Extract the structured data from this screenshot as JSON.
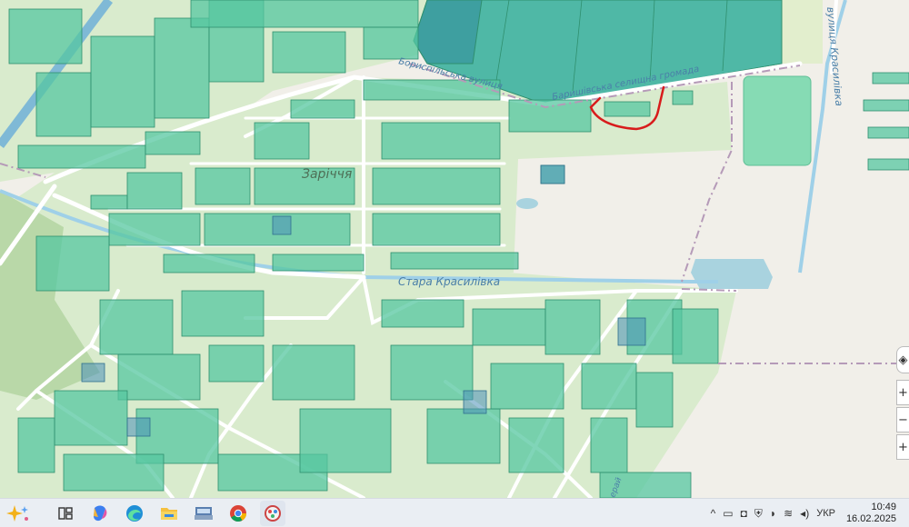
{
  "map": {
    "labels": {
      "village": "Заріччя",
      "river": "Стара Красилівка",
      "street_top": "Бориспільська вулиця",
      "community_border": "Баришівська селищна громада",
      "right_road": "вулиця Красилівка",
      "bottom_fragment": "ерай"
    },
    "colors": {
      "background": "#f1efe9",
      "residential": "#d9ebcd",
      "parcel_fill": "#55c7a0",
      "parcel_stroke": "#2f8f6e",
      "water": "#a9d3df",
      "river_line": "#9fd0e8",
      "boundary": "#b59ab8",
      "highlight_outline": "#d81c1c",
      "field_dark": "#3e9fa0"
    }
  },
  "zoom_controls": {
    "locate_icon": "locate-icon",
    "plus_label": "+",
    "minus_label": "−",
    "extra_label": "+"
  },
  "taskbar": {
    "apps": [
      {
        "name": "copilot-spark-icon"
      },
      {
        "name": "task-view-icon"
      },
      {
        "name": "copilot-app-icon"
      },
      {
        "name": "edge-icon"
      },
      {
        "name": "file-explorer-icon"
      },
      {
        "name": "scanner-app-icon"
      },
      {
        "name": "chrome-icon"
      },
      {
        "name": "paint-app-icon"
      }
    ],
    "tray": {
      "chevron": "^",
      "language": "УКР",
      "time": "10:49",
      "date": "16.02.2025"
    }
  }
}
